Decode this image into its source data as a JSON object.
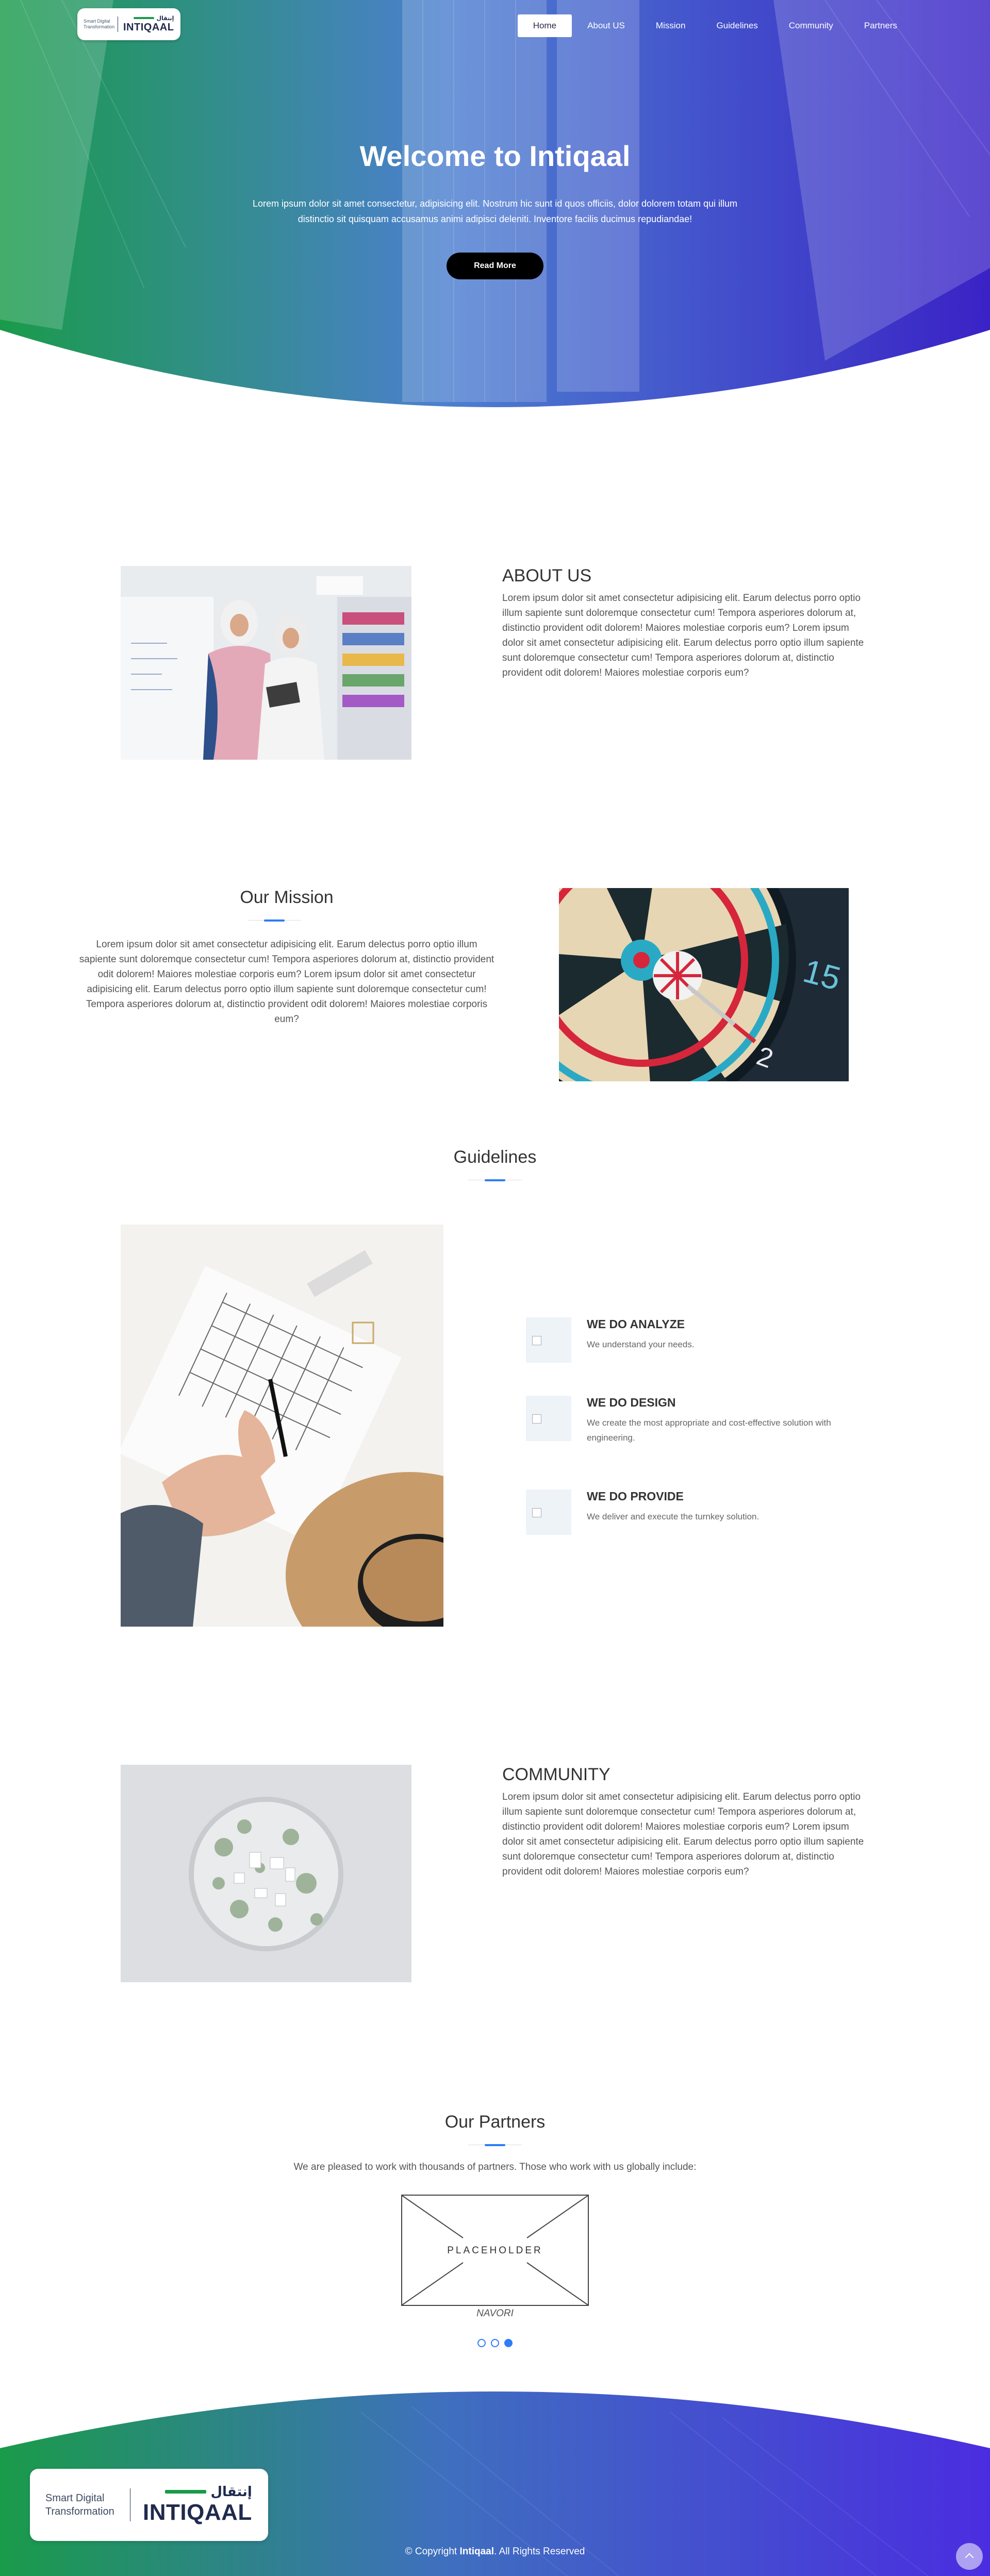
{
  "header": {
    "logo": {
      "tagline": "Smart Digital Transformation",
      "arabic": "إنتقال",
      "name": "INTIQAAL"
    },
    "nav": [
      {
        "label": "Home",
        "active": true
      },
      {
        "label": "About US",
        "active": false
      },
      {
        "label": "Mission",
        "active": false
      },
      {
        "label": "Guidelines",
        "active": false
      },
      {
        "label": "Community",
        "active": false
      },
      {
        "label": "Partners",
        "active": false
      }
    ]
  },
  "hero": {
    "title": "Welcome to Intiqaal",
    "text": "Lorem ipsum dolor sit amet consectetur, adipisicing elit. Nostrum hic sunt id quos officiis, dolor dolorem totam qui illum distinctio sit quisquam accusamus animi adipisci deleniti. Inventore facilis ducimus repudiandae!",
    "button": "Read More"
  },
  "about": {
    "title": "ABOUT US",
    "text": "Lorem ipsum dolor sit amet consectetur adipisicing elit. Earum delectus porro optio illum sapiente sunt doloremque consectetur cum! Tempora asperiores dolorum at, distinctio provident odit dolorem! Maiores molestiae corporis eum? Lorem ipsum dolor sit amet consectetur adipisicing elit. Earum delectus porro optio illum sapiente sunt doloremque consectetur cum! Tempora asperiores dolorum at, distinctio provident odit dolorem! Maiores molestiae corporis eum?"
  },
  "mission": {
    "title": "Our Mission",
    "text": "Lorem ipsum dolor sit amet consectetur adipisicing elit. Earum delectus porro optio illum sapiente sunt doloremque consectetur cum! Tempora asperiores dolorum at, distinctio provident odit dolorem! Maiores molestiae corporis eum? Lorem ipsum dolor sit amet consectetur adipisicing elit. Earum delectus porro optio illum sapiente sunt doloremque consectetur cum! Tempora asperiores dolorum at, distinctio provident odit dolorem! Maiores molestiae corporis eum?"
  },
  "guidelines": {
    "title": "Guidelines",
    "items": [
      {
        "title": "WE DO ANALYZE",
        "text": "We understand your needs."
      },
      {
        "title": "WE DO DESIGN",
        "text": "We create the most appropriate and cost-effective solution with engineering."
      },
      {
        "title": "WE DO PROVIDE",
        "text": "We deliver and execute the turnkey solution."
      }
    ]
  },
  "community": {
    "title": "COMMUNITY",
    "text": "Lorem ipsum dolor sit amet consectetur adipisicing elit. Earum delectus porro optio illum sapiente sunt doloremque consectetur cum! Tempora asperiores dolorum at, distinctio provident odit dolorem! Maiores molestiae corporis eum? Lorem ipsum dolor sit amet consectetur adipisicing elit. Earum delectus porro optio illum sapiente sunt doloremque consectetur cum! Tempora asperiores dolorum at, distinctio provident odit dolorem! Maiores molestiae corporis eum?"
  },
  "partners": {
    "title": "Our Partners",
    "subtitle": "We are pleased to work with thousands of partners. Those who work with us globally include:",
    "placeholder": "PLACEHOLDER",
    "partner_name": "NAVORI",
    "slides": 3,
    "active_slide": 3
  },
  "footer": {
    "logo": {
      "tagline": "Smart Digital Transformation",
      "arabic": "إنتقال",
      "name": "INTIQAAL"
    },
    "copyright_prefix": "© Copyright",
    "copyright_brand": "Intiqaal",
    "copyright_suffix": ". All Rights Reserved"
  },
  "colors": {
    "accent": "#2e7df6",
    "gradient_green": "#1a9b4a",
    "gradient_purple": "#4a2de0",
    "button_dark": "#000000"
  },
  "icons": [
    "chevron-up-icon",
    "broken-image-icon"
  ]
}
